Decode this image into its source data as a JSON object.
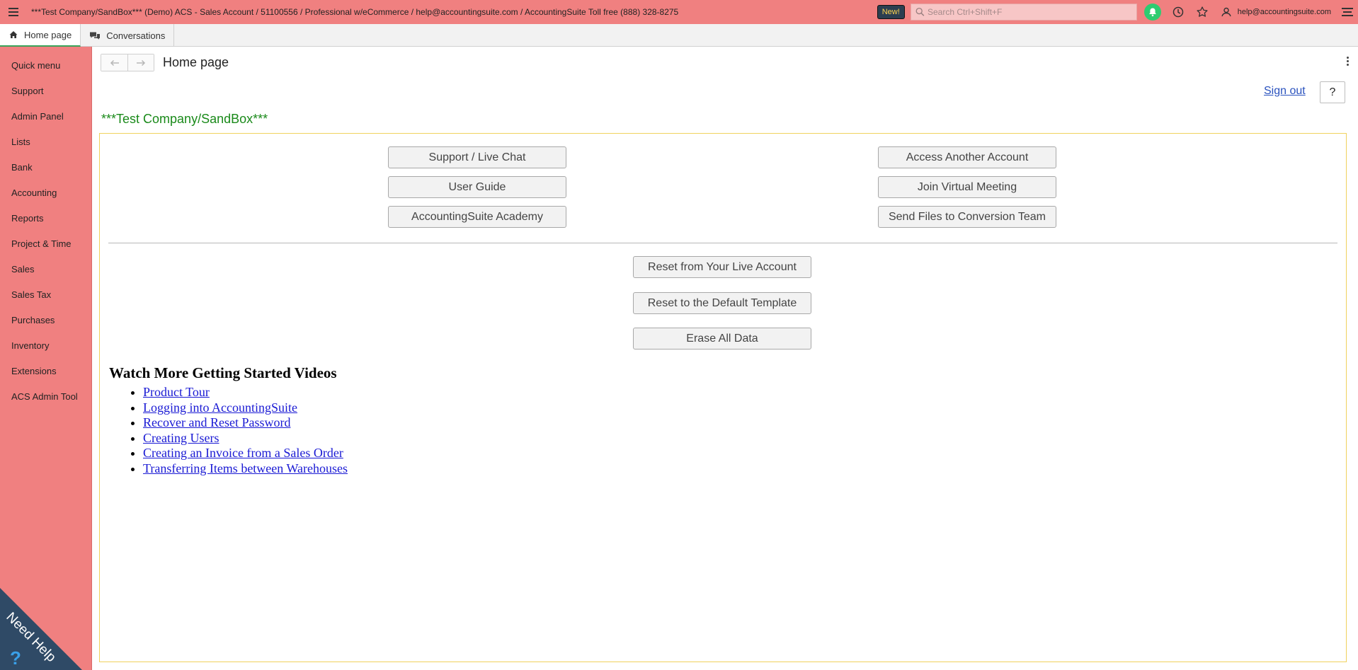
{
  "topbar": {
    "title": "***Test Company/SandBox*** (Demo) ACS - Sales Account / 51100556 / Professional w/eCommerce / help@accountingsuite.com / AccountingSuite Toll free (888) 328-8275",
    "new_badge": "New!",
    "search_placeholder": "Search Ctrl+Shift+F",
    "user_email": "help@accountingsuite.com",
    "colors": {
      "bar": "#f08080",
      "bell": "#2ecc71"
    }
  },
  "tabs": [
    {
      "label": "Home page",
      "icon": "home-icon",
      "active": true
    },
    {
      "label": "Conversations",
      "icon": "chat-icon",
      "active": false
    }
  ],
  "sidebar": {
    "items": [
      {
        "label": "Quick menu"
      },
      {
        "label": "Support"
      },
      {
        "label": "Admin Panel"
      },
      {
        "label": "Lists"
      },
      {
        "label": "Bank"
      },
      {
        "label": "Accounting"
      },
      {
        "label": "Reports"
      },
      {
        "label": "Project & Time"
      },
      {
        "label": "Sales"
      },
      {
        "label": "Sales Tax"
      },
      {
        "label": "Purchases"
      },
      {
        "label": "Inventory"
      },
      {
        "label": "Extensions"
      },
      {
        "label": "ACS Admin Tool"
      }
    ],
    "need_help_label": "Need Help"
  },
  "main": {
    "page_title": "Home page",
    "sign_out": "Sign out",
    "help_label": "?",
    "company_name": "***Test Company/SandBox***",
    "buttons_left": [
      "Support / Live Chat",
      "User Guide",
      "AccountingSuite Academy"
    ],
    "buttons_right": [
      "Access Another Account",
      "Join Virtual Meeting",
      "Send Files to Conversion Team"
    ],
    "reset_buttons": [
      "Reset from Your Live Account",
      "Reset to the Default Template",
      "Erase All Data"
    ],
    "videos_heading": "Watch More Getting Started Videos",
    "videos": [
      "Product Tour",
      "Logging into AccountingSuite",
      "Recover and Reset Password",
      "Creating Users",
      "Creating an Invoice from a Sales Order",
      "Transferring Items between Warehouses"
    ]
  }
}
